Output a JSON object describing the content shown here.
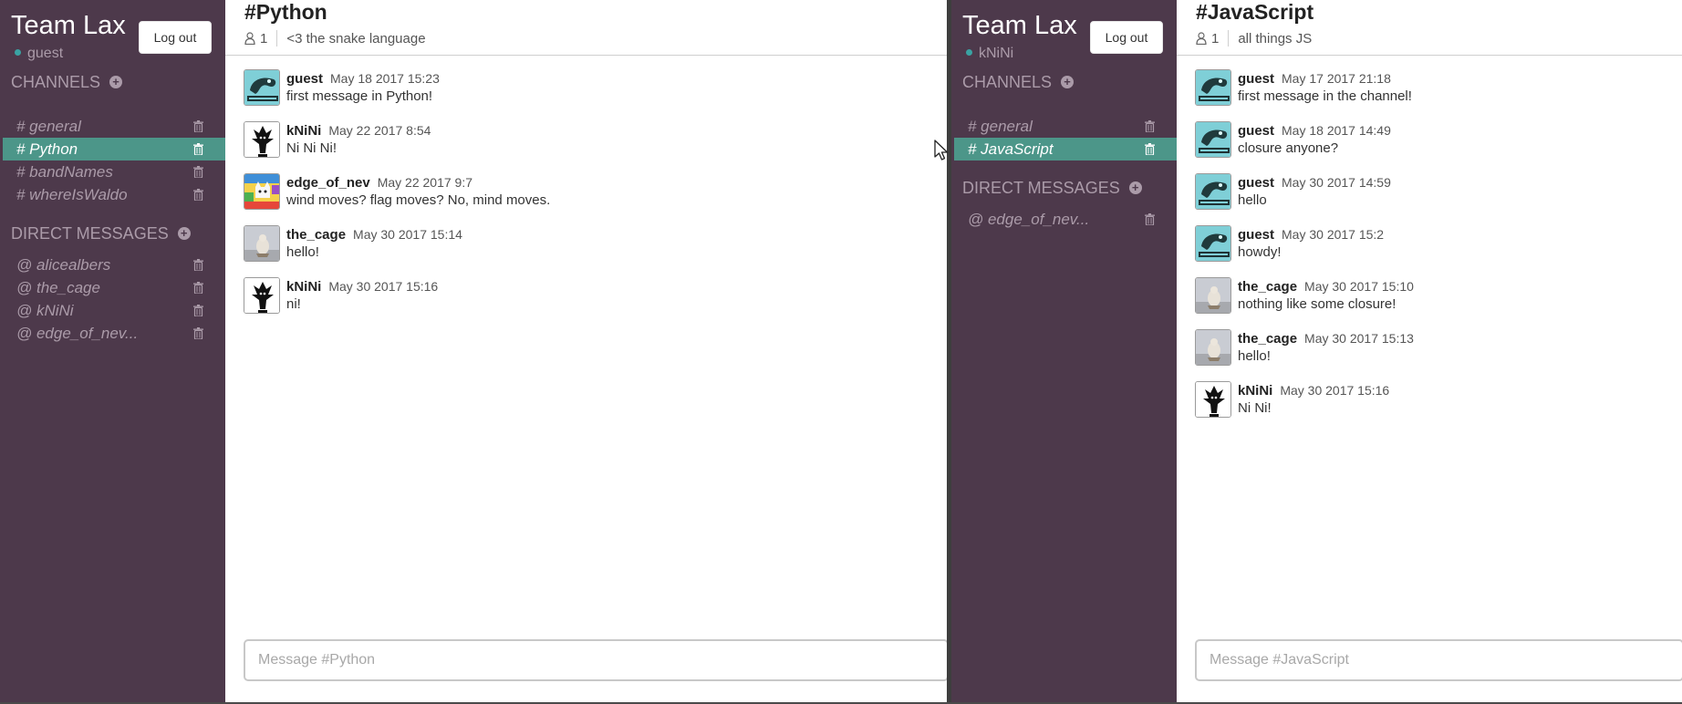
{
  "left": {
    "team_name": "Team Lax",
    "username": "guest",
    "logout_label": "Log out",
    "channels_header": "CHANNELS",
    "channels": [
      {
        "label": "# general",
        "active": false
      },
      {
        "label": "# Python",
        "active": true
      },
      {
        "label": "# bandNames",
        "active": false
      },
      {
        "label": "# whereIsWaldo",
        "active": false
      }
    ],
    "dm_header": "DIRECT MESSAGES",
    "dms": [
      {
        "label": "@ alicealbers"
      },
      {
        "label": "@ the_cage"
      },
      {
        "label": "@ kNiNi"
      },
      {
        "label": "@ edge_of_nev..."
      }
    ],
    "channel_title": "#Python",
    "member_count": "1",
    "topic": "<3 the snake language",
    "messages": [
      {
        "author": "guest",
        "time": "May 18 2017 15:23",
        "text": "first message in Python!",
        "avatar": "philosoraptor"
      },
      {
        "author": "kNiNi",
        "time": "May 22 2017 8:54",
        "text": "Ni Ni Ni!",
        "avatar": "ni-tree"
      },
      {
        "author": "edge_of_nev",
        "time": "May 22 2017 9:7",
        "text": "wind moves? flag moves? No, mind moves.",
        "avatar": "colorful-cat"
      },
      {
        "author": "the_cage",
        "time": "May 30 2017 15:14",
        "text": "hello!",
        "avatar": "cage"
      },
      {
        "author": "kNiNi",
        "time": "May 30 2017 15:16",
        "text": "ni!",
        "avatar": "ni-tree"
      }
    ],
    "input_placeholder": "Message #Python"
  },
  "right": {
    "team_name": "Team Lax",
    "username": "kNiNi",
    "logout_label": "Log out",
    "channels_header": "CHANNELS",
    "channels": [
      {
        "label": "# general",
        "active": false
      },
      {
        "label": "# JavaScript",
        "active": true
      }
    ],
    "dm_header": "DIRECT MESSAGES",
    "dms": [
      {
        "label": "@ edge_of_nev..."
      }
    ],
    "channel_title": "#JavaScript",
    "member_count": "1",
    "topic": "all things JS",
    "messages": [
      {
        "author": "guest",
        "time": "May 17 2017 21:18",
        "text": "first message in the channel!",
        "avatar": "philosoraptor"
      },
      {
        "author": "guest",
        "time": "May 18 2017 14:49",
        "text": "closure anyone?",
        "avatar": "philosoraptor"
      },
      {
        "author": "guest",
        "time": "May 30 2017 14:59",
        "text": "hello",
        "avatar": "philosoraptor"
      },
      {
        "author": "guest",
        "time": "May 30 2017 15:2",
        "text": "howdy!",
        "avatar": "philosoraptor"
      },
      {
        "author": "the_cage",
        "time": "May 30 2017 15:10",
        "text": "nothing like some closure!",
        "avatar": "cage"
      },
      {
        "author": "the_cage",
        "time": "May 30 2017 15:13",
        "text": "hello!",
        "avatar": "cage"
      },
      {
        "author": "kNiNi",
        "time": "May 30 2017 15:16",
        "text": "Ni Ni!",
        "avatar": "ni-tree"
      }
    ],
    "input_placeholder": "Message #JavaScript"
  },
  "colors": {
    "sidebar_bg": "#4d394b",
    "sidebar_text": "#ab9ba9",
    "active_channel": "#4c9689",
    "online_dot": "#3aa3a3"
  },
  "icons": [
    "plus-circle-icon",
    "trash-icon",
    "user-icon",
    "mouse-pointer-icon"
  ]
}
